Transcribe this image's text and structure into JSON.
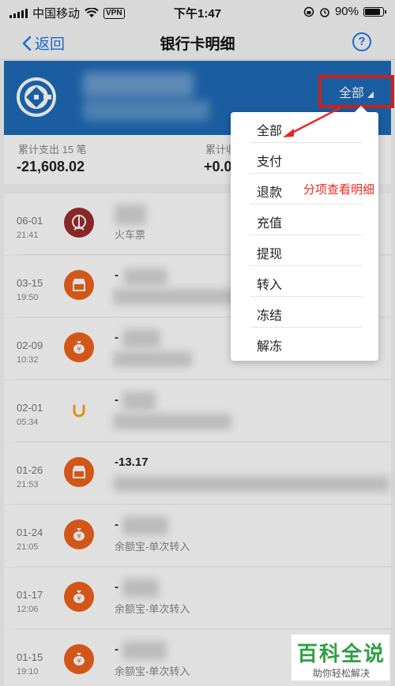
{
  "status_bar": {
    "carrier": "中国移动",
    "vpn": "VPN",
    "time": "下午1:47",
    "battery": "90%"
  },
  "nav": {
    "back_label": "返回",
    "title": "银行卡明细",
    "help_label": "?"
  },
  "filter": {
    "selected": "全部"
  },
  "summary": {
    "expense_label": "累计支出 15 笔",
    "expense_value": "-21,608.02",
    "income_label": "累计收",
    "income_value": "+0.0"
  },
  "transactions": [
    {
      "date": "06-01",
      "time": "21:41",
      "amount": "",
      "desc": "火车票",
      "icon": "train-ticket-icon",
      "color": "#9b2d2d"
    },
    {
      "date": "03-15",
      "time": "19:50",
      "amount": "-",
      "desc": "",
      "icon": "shop-icon",
      "color": "#f0621c"
    },
    {
      "date": "02-09",
      "time": "10:32",
      "amount": "-",
      "desc": "",
      "icon": "money-bag-icon",
      "color": "#f0621c"
    },
    {
      "date": "02-01",
      "time": "05:34",
      "amount": "-",
      "desc": "",
      "icon": "didi-icon",
      "color": "#f5a623"
    },
    {
      "date": "01-26",
      "time": "21:53",
      "amount": "-13.17",
      "desc": "",
      "icon": "shop-icon",
      "color": "#f0621c"
    },
    {
      "date": "01-24",
      "time": "21:05",
      "amount": "-",
      "desc": "余额宝-单次转入",
      "icon": "money-bag-icon",
      "color": "#f0621c"
    },
    {
      "date": "01-17",
      "time": "12:06",
      "amount": "-",
      "desc": "余额宝-单次转入",
      "icon": "money-bag-icon",
      "color": "#f0621c"
    },
    {
      "date": "01-15",
      "time": "19:10",
      "amount": "-",
      "desc": "余额宝-单次转入",
      "icon": "money-bag-icon",
      "color": "#f0621c"
    }
  ],
  "menu": {
    "items": [
      "全部",
      "支付",
      "退款",
      "充值",
      "提现",
      "转入",
      "冻结",
      "解冻"
    ]
  },
  "annotation": "分项查看明细",
  "watermark": {
    "main": "百科全说",
    "sub": "助你轻松解决"
  },
  "colors": {
    "accent": "#1e7be5",
    "bank_header": "#1e6bb8",
    "highlight_red": "#e8281f",
    "watermark_green": "#2ea043"
  }
}
